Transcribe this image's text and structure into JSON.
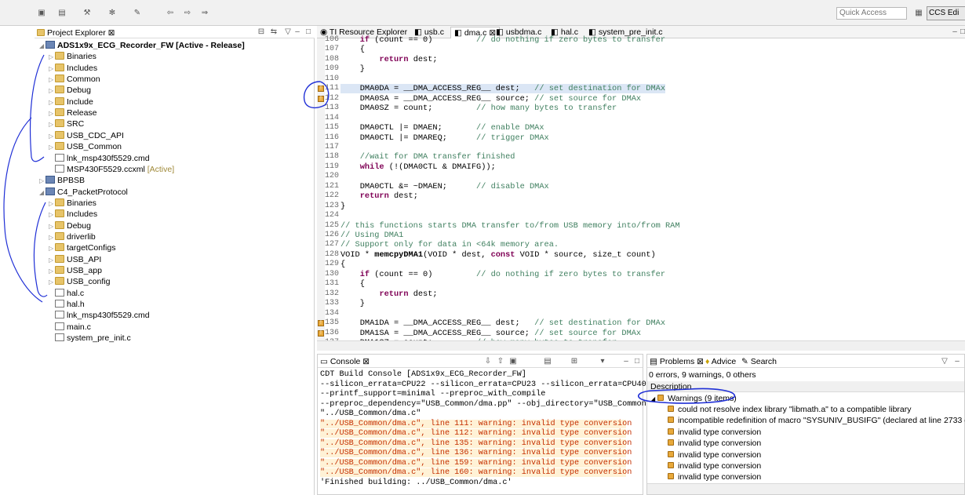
{
  "toolbar": {
    "quick_access": "Quick Access",
    "perspective_label": "CCS Edi"
  },
  "project_explorer": {
    "title": "Project Explorer",
    "items": [
      {
        "label": "ADS1x9x_ECG_Recorder_FW",
        "suffix": "[Active - Release]",
        "type": "project"
      },
      {
        "label": "Binaries",
        "type": "folder"
      },
      {
        "label": "Includes",
        "type": "folder"
      },
      {
        "label": "Common",
        "type": "folder"
      },
      {
        "label": "Debug",
        "type": "folder"
      },
      {
        "label": "Include",
        "type": "folder"
      },
      {
        "label": "Release",
        "type": "folder"
      },
      {
        "label": "SRC",
        "type": "folder"
      },
      {
        "label": "USB_CDC_API",
        "type": "folder"
      },
      {
        "label": "USB_Common",
        "type": "folder"
      },
      {
        "label": "lnk_msp430f5529.cmd",
        "type": "file"
      },
      {
        "label": "MSP430F5529.ccxml",
        "suffix": "[Active]",
        "type": "file"
      },
      {
        "label": "BPBSB",
        "type": "project"
      },
      {
        "label": "C4_PacketProtocol",
        "type": "project"
      },
      {
        "label": "Binaries",
        "type": "folder"
      },
      {
        "label": "Includes",
        "type": "folder"
      },
      {
        "label": "Debug",
        "type": "folder"
      },
      {
        "label": "driverlib",
        "type": "folder"
      },
      {
        "label": "targetConfigs",
        "type": "folder"
      },
      {
        "label": "USB_API",
        "type": "folder"
      },
      {
        "label": "USB_app",
        "type": "folder"
      },
      {
        "label": "USB_config",
        "type": "folder"
      },
      {
        "label": "hal.c",
        "type": "file"
      },
      {
        "label": "hal.h",
        "type": "file"
      },
      {
        "label": "lnk_msp430f5529.cmd",
        "type": "file"
      },
      {
        "label": "main.c",
        "type": "file"
      },
      {
        "label": "system_pre_init.c",
        "type": "file"
      }
    ]
  },
  "editor": {
    "tabs": [
      "TI Resource Explorer",
      "usb.c",
      "dma.c",
      "usbdma.c",
      "hal.c",
      "system_pre_init.c"
    ],
    "active_tab": "dma.c",
    "lines": [
      {
        "n": "106",
        "t": "    if (count == 0)         // do nothing if zero bytes to transfer"
      },
      {
        "n": "107",
        "t": "    {"
      },
      {
        "n": "108",
        "t": "        return dest;"
      },
      {
        "n": "109",
        "t": "    }"
      },
      {
        "n": "110",
        "t": ""
      },
      {
        "n": "111",
        "t": "    DMA0DA = __DMA_ACCESS_REG__ dest;   // set destination for DMAx",
        "w": true,
        "hl": true
      },
      {
        "n": "112",
        "t": "    DMA0SA = __DMA_ACCESS_REG__ source; // set source for DMAx",
        "w": true
      },
      {
        "n": "113",
        "t": "    DMA0SZ = count;         // how many bytes to transfer"
      },
      {
        "n": "114",
        "t": ""
      },
      {
        "n": "115",
        "t": "    DMA0CTL |= DMAEN;       // enable DMAx"
      },
      {
        "n": "116",
        "t": "    DMA0CTL |= DMAREQ;      // trigger DMAx"
      },
      {
        "n": "117",
        "t": ""
      },
      {
        "n": "118",
        "t": "    //wait for DMA transfer finished"
      },
      {
        "n": "119",
        "t": "    while (!(DMA0CTL & DMAIFG));"
      },
      {
        "n": "120",
        "t": ""
      },
      {
        "n": "121",
        "t": "    DMA0CTL &= ~DMAEN;      // disable DMAx"
      },
      {
        "n": "122",
        "t": "    return dest;"
      },
      {
        "n": "123",
        "t": "}"
      },
      {
        "n": "124",
        "t": ""
      },
      {
        "n": "125",
        "t": "// this functions starts DMA transfer to/from USB memory into/from RAM"
      },
      {
        "n": "126",
        "t": "// Using DMA1"
      },
      {
        "n": "127",
        "t": "// Support only for data in <64k memory area."
      },
      {
        "n": "128",
        "t": "VOID * memcpyDMA1(VOID * dest, const VOID * source, size_t count)"
      },
      {
        "n": "129",
        "t": "{"
      },
      {
        "n": "130",
        "t": "    if (count == 0)         // do nothing if zero bytes to transfer"
      },
      {
        "n": "131",
        "t": "    {"
      },
      {
        "n": "132",
        "t": "        return dest;"
      },
      {
        "n": "133",
        "t": "    }"
      },
      {
        "n": "134",
        "t": ""
      },
      {
        "n": "135",
        "t": "    DMA1DA = __DMA_ACCESS_REG__ dest;   // set destination for DMAx",
        "w": true
      },
      {
        "n": "136",
        "t": "    DMA1SA = __DMA_ACCESS_REG__ source; // set source for DMAx",
        "w": true
      },
      {
        "n": "137",
        "t": "    DMA1SZ = count;         // how many bytes to transfer"
      }
    ]
  },
  "console": {
    "tab": "Console",
    "title": "CDT Build Console [ADS1x9x_ECG_Recorder_FW]",
    "lines": [
      {
        "t": "--silicon_errata=CPU22 --silicon_errata=CPU23 --silicon_errata=CPU40"
      },
      {
        "t": "--printf_support=minimal --preproc_with_compile"
      },
      {
        "t": "--preproc_dependency=\"USB_Common/dma.pp\" --obj_directory=\"USB_Common\""
      },
      {
        "t": "\"../USB_Common/dma.c\""
      },
      {
        "t": "\"../USB_Common/dma.c\", line 111: warning: invalid type conversion",
        "warn": true
      },
      {
        "t": "\"../USB_Common/dma.c\", line 112: warning: invalid type conversion",
        "warn": true
      },
      {
        "t": "\"../USB_Common/dma.c\", line 135: warning: invalid type conversion",
        "warn": true
      },
      {
        "t": "\"../USB_Common/dma.c\", line 136: warning: invalid type conversion",
        "warn": true
      },
      {
        "t": "\"../USB_Common/dma.c\", line 159: warning: invalid type conversion",
        "warn": true
      },
      {
        "t": "\"../USB_Common/dma.c\", line 160: warning: invalid type conversion",
        "warn": true
      },
      {
        "t": "'Finished building: ../USB_Common/dma.c'"
      }
    ]
  },
  "problems": {
    "tabs": [
      "Problems",
      "Advice",
      "Search"
    ],
    "summary": "0 errors, 9 warnings, 0 others",
    "column": "Description",
    "group": "Warnings (9 items)",
    "items": [
      "could not resolve index library \"libmath.a\" to a compatible library",
      "incompatible redefinition of macro \"SYSUNIV_BUSIFG\" (declared at line 2733 of \"c:\\ti\\cc",
      "invalid type conversion",
      "invalid type conversion",
      "invalid type conversion",
      "invalid type conversion",
      "invalid type conversion"
    ]
  },
  "colors": {
    "warning": "#e8a93a",
    "annotation": "#1f2fd6",
    "selection": "#dbe6f5"
  }
}
